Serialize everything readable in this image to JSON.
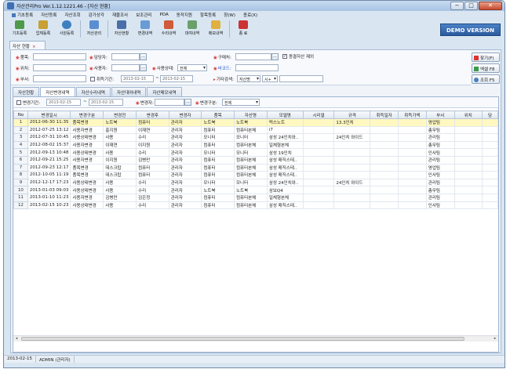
{
  "window": {
    "title": "자산관리Pro Ver.1.12.1221.46 - [자산 현황]",
    "min": "−",
    "max": "□",
    "close": "✕"
  },
  "menu": [
    "기초등록",
    "자산등록",
    "자산조회",
    "감가상각",
    "재물조사",
    "보조관리",
    "PDA",
    "동작지원",
    "항목등록",
    "창(W)",
    "종료(X)"
  ],
  "toolbar": [
    {
      "label": "기초등록",
      "color": "#4f9a4a"
    },
    {
      "label": "업체등록",
      "color": "#c8a033"
    },
    {
      "label": "사원등록",
      "color": "#3f7fc0"
    },
    {
      "label": "자산관리",
      "color": "#5a8ed0"
    },
    {
      "label": "자산현황",
      "color": "#4a6fa8"
    },
    {
      "label": "변경내역",
      "color": "#6a9bd4"
    },
    {
      "label": "수리내역",
      "color": "#d05a3a"
    },
    {
      "label": "대여내역",
      "color": "#6aa06a"
    },
    {
      "label": "메모내역",
      "color": "#e0b040"
    },
    {
      "label": "종 료",
      "color": "#cc3333"
    }
  ],
  "demo_label": "DEMO VERSION",
  "doc_tab": {
    "label": "자산 현황",
    "close": "×"
  },
  "filters": {
    "item": "품목:",
    "location": "위치:",
    "dept": "부서:",
    "manager": "담당자:",
    "user": "사용자:",
    "acq_period": "취득기간:",
    "status": "사용상태:",
    "status_value": "전체",
    "purchaser": "구매처:",
    "barcode": "바코드:",
    "other_search": "기타검색:",
    "other_value": "자산명",
    "other_op": "시+",
    "exclude_disposed": "종결자산 제외",
    "date_from": "2013-02-15",
    "date_to": "2013-02-15"
  },
  "right_buttons": {
    "search": "찾기(F)",
    "excel": "엑셀 F8",
    "query": "조회 F5"
  },
  "sub_tabs": [
    "자산현황",
    "자산변경내역",
    "자산수리내역",
    "자산대여내역",
    "자산메모내역"
  ],
  "panel_filter": {
    "period_label": "변경기간:",
    "from": "2013-02-15",
    "to": "2013-02-15",
    "changer_label": "변경자:",
    "type_label": "변경구분:",
    "type_value": "전체"
  },
  "grid": {
    "headers": [
      "No",
      "변경일시",
      "변경구분",
      "변경전",
      "변경후",
      "변경자",
      "품목",
      "자산명",
      "모델명",
      "시리얼",
      "규격",
      "취득일자",
      "취득가액",
      "부서",
      "위치",
      "담"
    ],
    "rows": [
      [
        "1",
        "2012-06-30 11:35",
        "품목변경",
        "노트북",
        "컴퓨터",
        "관리자",
        "노트북",
        "노트북",
        "럭스노트",
        "",
        "13.3인치",
        "",
        "",
        "영업팀",
        "",
        ""
      ],
      [
        "2",
        "2012-07-25 13:12",
        "사용자변경",
        "홍지원",
        "이재연",
        "관리자",
        "컴퓨터",
        "컴퓨터본체",
        "i7",
        "",
        "",
        "",
        "",
        "총무팀",
        "",
        ""
      ],
      [
        "3",
        "2012-07-31 10:45",
        "사용상태변경",
        "사용",
        "수리",
        "관리자",
        "모니터",
        "모니터",
        "삼성 24인치와..",
        "",
        "24인치 와이드",
        "",
        "",
        "관리팀",
        "",
        ""
      ],
      [
        "4",
        "2012-08-02 15:37",
        "사용자변경",
        "이재연",
        "이지원",
        "관리자",
        "컴퓨터",
        "컴퓨터본체",
        "일체형본체",
        "",
        "",
        "",
        "",
        "총무팀",
        "",
        ""
      ],
      [
        "5",
        "2012-09-13 10:48",
        "사용상태변경",
        "사용",
        "수리",
        "관리자",
        "모니터",
        "모니터",
        "삼성 19인치",
        "",
        "",
        "",
        "",
        "인사팀",
        "",
        ""
      ],
      [
        "6",
        "2012-09-21 15:25",
        "사용자변경",
        "이지원",
        "김병만",
        "관리자",
        "컴퓨터",
        "컴퓨터본체",
        "삼성 매직스테..",
        "",
        "",
        "",
        "",
        "관리팀",
        "",
        ""
      ],
      [
        "7",
        "2012-09-23 12:17",
        "품목변경",
        "데스크탑",
        "컴퓨터",
        "관리자",
        "컴퓨터",
        "컴퓨터본체",
        "삼성 매직스테..",
        "",
        "",
        "",
        "",
        "영업팀",
        "",
        ""
      ],
      [
        "8",
        "2012-10-05 11:19",
        "품목변경",
        "데스크탑",
        "컴퓨터",
        "관리자",
        "컴퓨터",
        "컴퓨터본체",
        "삼성 매직스테..",
        "",
        "",
        "",
        "",
        "인사팀",
        "",
        ""
      ],
      [
        "9",
        "2012-12-17 17:23",
        "사용상태변경",
        "사용",
        "수리",
        "관리자",
        "모니터",
        "모니터",
        "삼성 24인치와..",
        "",
        "24인치 와이드",
        "",
        "",
        "관리팀",
        "",
        ""
      ],
      [
        "10",
        "2013-01-03 09:03",
        "사용상태변경",
        "사용",
        "수리",
        "관리자",
        "노트북",
        "노트북",
        "삼보Q4",
        "",
        "",
        "",
        "",
        "총무팀",
        "",
        ""
      ],
      [
        "11",
        "2013-01-10 11:23",
        "사용자변경",
        "김병만",
        "김은정",
        "관리자",
        "컴퓨터",
        "컴퓨터본체",
        "일체형본체",
        "",
        "",
        "",
        "",
        "관리팀",
        "",
        ""
      ],
      [
        "12",
        "2013-02-15 10:23",
        "사용상태변경",
        "사용",
        "수리",
        "관리자",
        "컴퓨터",
        "컴퓨터본체",
        "삼성 매직스테..",
        "",
        "",
        "",
        "",
        "인사팀",
        "",
        ""
      ]
    ]
  },
  "status": {
    "date": "2013-02-15",
    "user": "ADMIN (관리자)"
  }
}
